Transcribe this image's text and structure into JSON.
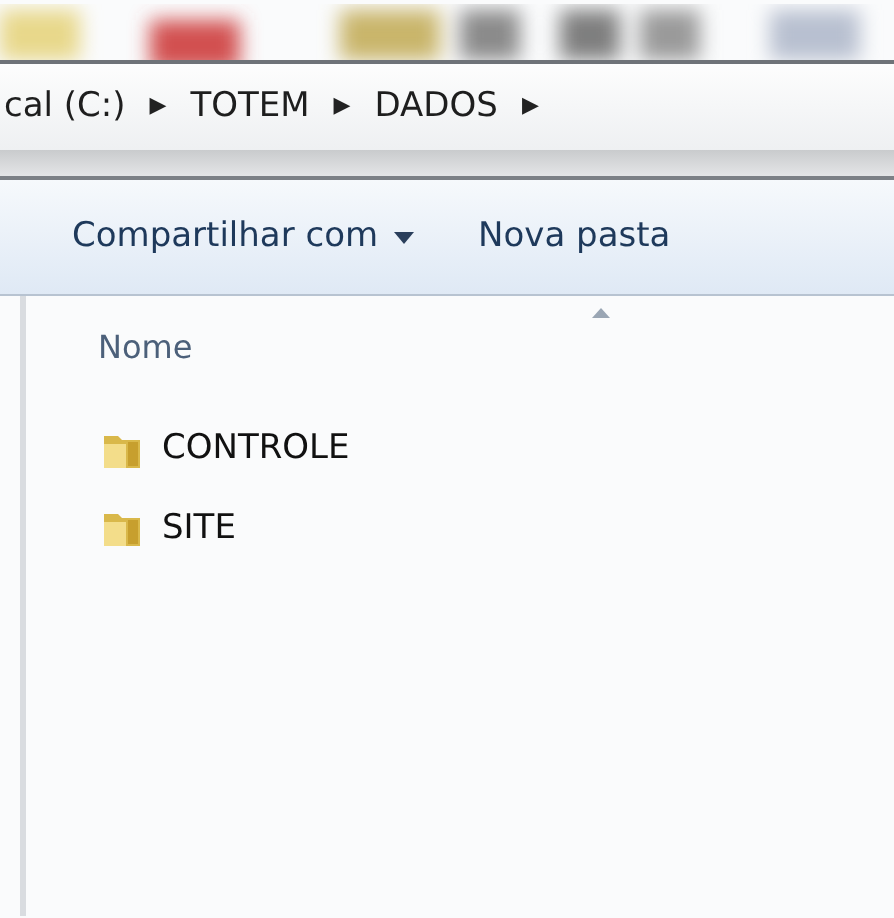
{
  "address_bar": {
    "crumbs": [
      {
        "label": "cal (C:)",
        "separator": "▶"
      },
      {
        "label": "TOTEM",
        "separator": "▶"
      },
      {
        "label": "DADOS",
        "separator": "▶"
      }
    ]
  },
  "toolbar": {
    "buttons": [
      {
        "label": "Compartilhar com",
        "dropdown": true
      },
      {
        "label": "Nova pasta",
        "dropdown": false
      }
    ]
  },
  "file_list": {
    "columns": [
      {
        "label": "Nome",
        "sorted": true
      }
    ],
    "items": [
      {
        "name": "CONTROLE",
        "kind": "folder"
      },
      {
        "name": "SITE",
        "kind": "folder"
      }
    ]
  }
}
